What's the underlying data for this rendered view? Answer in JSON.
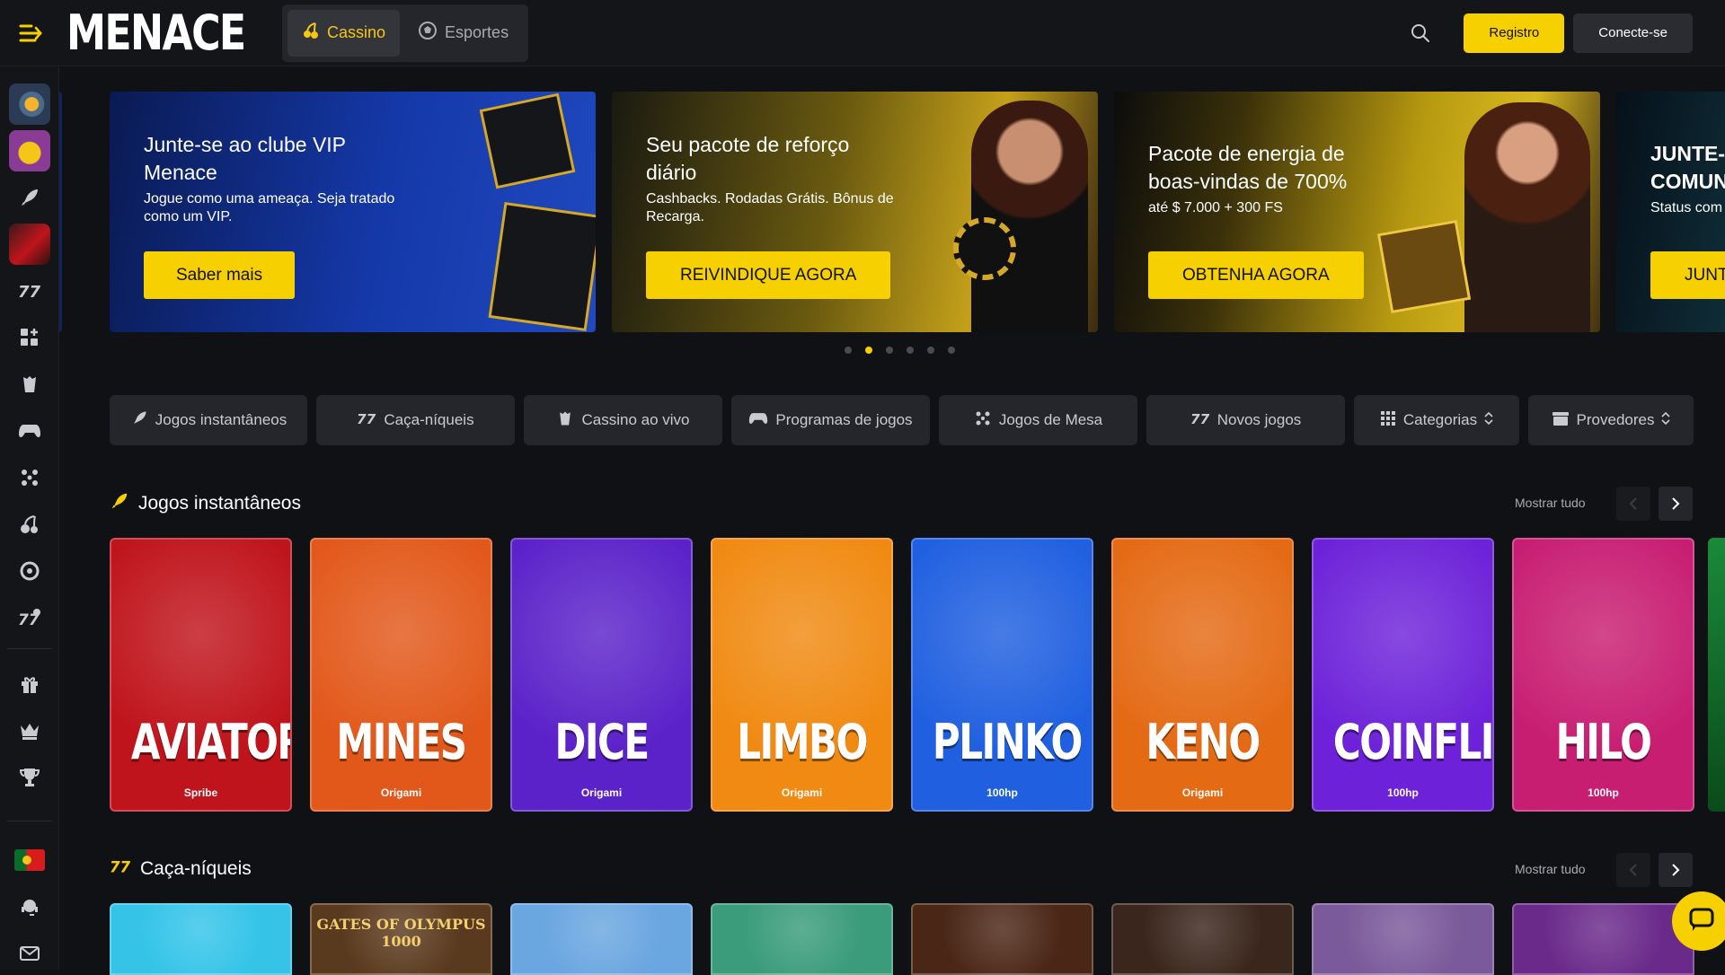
{
  "header": {
    "logo": "MENACE",
    "modes": [
      {
        "label": "Cassino",
        "active": true
      },
      {
        "label": "Esportes",
        "active": false
      }
    ],
    "register_label": "Registro",
    "login_label": "Conecte-se"
  },
  "sidebar": {
    "icons": [
      "game-thumb-1",
      "game-thumb-2",
      "rocket-icon",
      "game-thumb-3",
      "slots-icon",
      "grid-plus-icon",
      "live-casino-icon",
      "gamepad-icon",
      "table-games-icon",
      "cherry-icon",
      "wheel-icon",
      "new-games-icon",
      "gift-icon",
      "crown-icon",
      "trophy-icon",
      "portugal-flag-icon",
      "support-icon",
      "mail-icon"
    ]
  },
  "banners": [
    {
      "title": "Junte-se ao clube VIP Menace",
      "text": "Jogue como uma ameaça. Seja tratado como um VIP.",
      "cta": "Saber mais"
    },
    {
      "title": "Seu pacote de reforço diário",
      "text": "Cashbacks. Rodadas Grátis. Bônus de Recarga.",
      "cta": "REIVINDIQUE AGORA"
    },
    {
      "title": "Pacote de energia de boas-vindas de 700%",
      "text": "até $ 7.000 + 300 FS",
      "cta": "OBTENHA AGORA"
    },
    {
      "title": "JUNTE-SE À COMUNIDADE",
      "text": "Status com",
      "cta": "JUNTE"
    }
  ],
  "carousel": {
    "count": 6,
    "active_index": 1
  },
  "filters": [
    {
      "label": "Jogos instantâneos",
      "icon": "rocket-icon"
    },
    {
      "label": "Caça-níqueis",
      "icon": "slots-icon"
    },
    {
      "label": "Cassino ao vivo",
      "icon": "live-casino-icon"
    },
    {
      "label": "Programas de jogos",
      "icon": "gamepad-icon"
    },
    {
      "label": "Jogos de Mesa",
      "icon": "table-games-icon"
    },
    {
      "label": "Novos jogos",
      "icon": "new-games-icon"
    },
    {
      "label": "Categorias",
      "icon": "grid-icon"
    },
    {
      "label": "Provedores",
      "icon": "provider-icon"
    }
  ],
  "sections": {
    "instant": {
      "title": "Jogos instantâneos",
      "show_all": "Mostrar tudo",
      "games": [
        {
          "name": "AVIATOR",
          "provider": "Spribe",
          "color": "#c0141c"
        },
        {
          "name": "MINES",
          "provider": "Origami",
          "color": "#e2581a"
        },
        {
          "name": "DICE",
          "provider": "Origami",
          "color": "#5b22c9"
        },
        {
          "name": "LIMBO",
          "provider": "Origami",
          "color": "#f08a12"
        },
        {
          "name": "PLINKO",
          "provider": "100hp",
          "color": "#1f5fe0"
        },
        {
          "name": "KENO",
          "provider": "Origami",
          "color": "#e46a14"
        },
        {
          "name": "COINFLIP",
          "provider": "100hp",
          "color": "#6d22d9"
        },
        {
          "name": "HILO",
          "provider": "100hp",
          "color": "#c81e72"
        }
      ]
    },
    "slots": {
      "title": "Caça-níqueis",
      "show_all": "Mostrar tudo",
      "games": [
        {
          "name": "",
          "color": "#35c4e8"
        },
        {
          "name": "GATES OF OLYMPUS 1000",
          "color": "#5a3a1e"
        },
        {
          "name": "",
          "color": "#6aa6e0"
        },
        {
          "name": "",
          "color": "#3a9c7a"
        },
        {
          "name": "",
          "color": "#4a2616"
        },
        {
          "name": "",
          "color": "#3a261c"
        },
        {
          "name": "",
          "color": "#7a5a9a"
        },
        {
          "name": "",
          "color": "#6a2a8a"
        }
      ]
    }
  },
  "colors": {
    "accent": "#f7d000",
    "bg": "#101114",
    "panel": "#24262b"
  }
}
